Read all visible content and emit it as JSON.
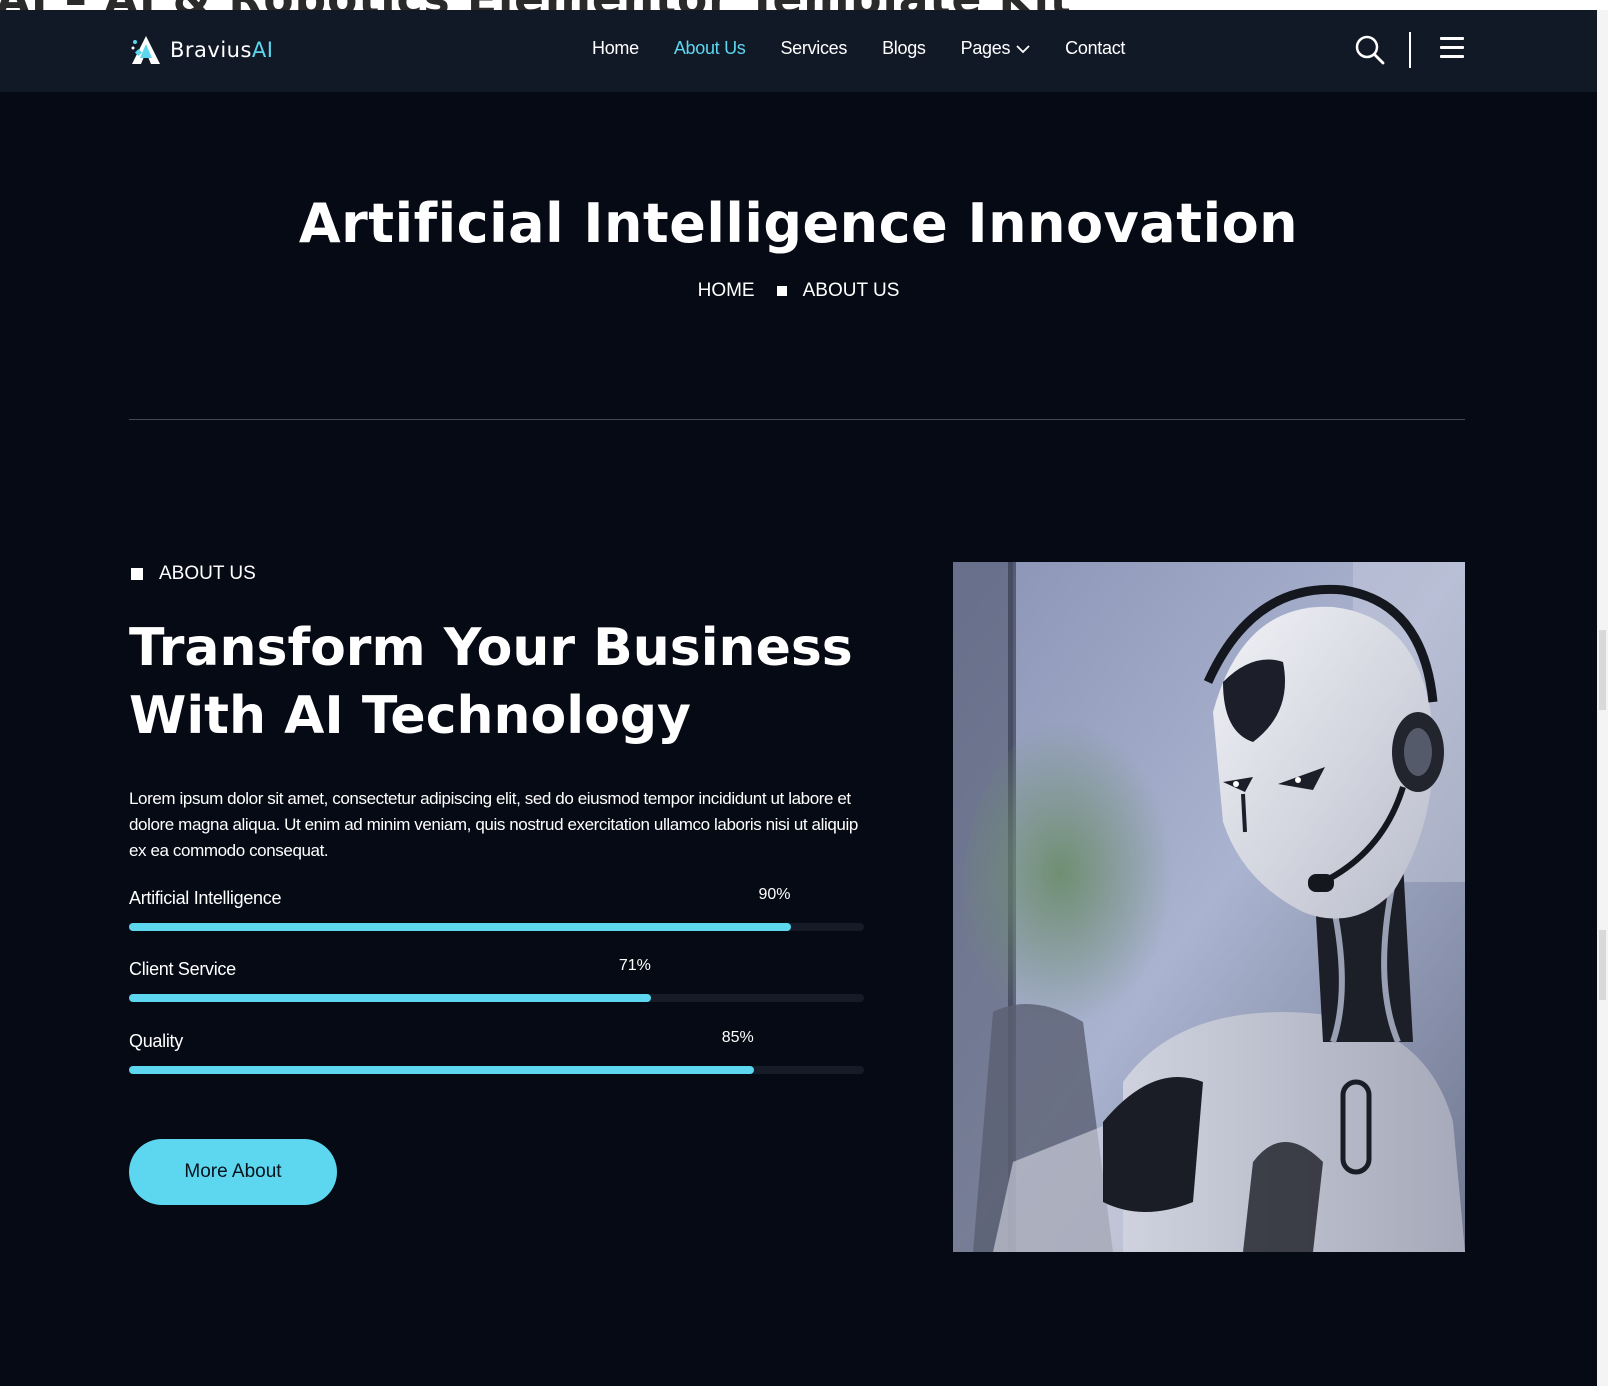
{
  "browser_bg_title": "AI – AI & Robotics Elementor Template Kit",
  "brand": {
    "name": "Bravius",
    "suffix": "AI",
    "accent": "#5cd7ef"
  },
  "nav": {
    "items": [
      {
        "label": "Home",
        "active": false
      },
      {
        "label": "About Us",
        "active": true
      },
      {
        "label": "Services",
        "active": false
      },
      {
        "label": "Blogs",
        "active": false
      },
      {
        "label": "Pages",
        "active": false,
        "dropdown": true
      },
      {
        "label": "Contact",
        "active": false
      }
    ],
    "icons": [
      "search-icon",
      "menu-icon"
    ]
  },
  "hero": {
    "title": "Artificial Intelligence Innovation",
    "breadcrumb": [
      "HOME",
      "ABOUT US"
    ]
  },
  "about": {
    "tag": "ABOUT US",
    "heading": "Transform Your Business With AI Technology",
    "paragraph": "Lorem ipsum dolor sit amet, consectetur adipiscing elit, sed do eiusmod tempor incididunt ut labore et dolore magna aliqua. Ut enim ad minim veniam, quis nostrud exercitation ullamco laboris nisi ut aliquip ex ea commodo consequat.",
    "skills": [
      {
        "label": "Artificial Intelligence",
        "value_text": "90%",
        "value": 90
      },
      {
        "label": "Client Service",
        "value_text": "71%",
        "value": 71
      },
      {
        "label": "Quality",
        "value_text": "85%",
        "value": 85
      }
    ],
    "button": "More About",
    "image": "robot-with-headset"
  },
  "colors": {
    "page_bg": "#060a14",
    "header_bg": "#111826",
    "accent": "#5cd7ef"
  }
}
